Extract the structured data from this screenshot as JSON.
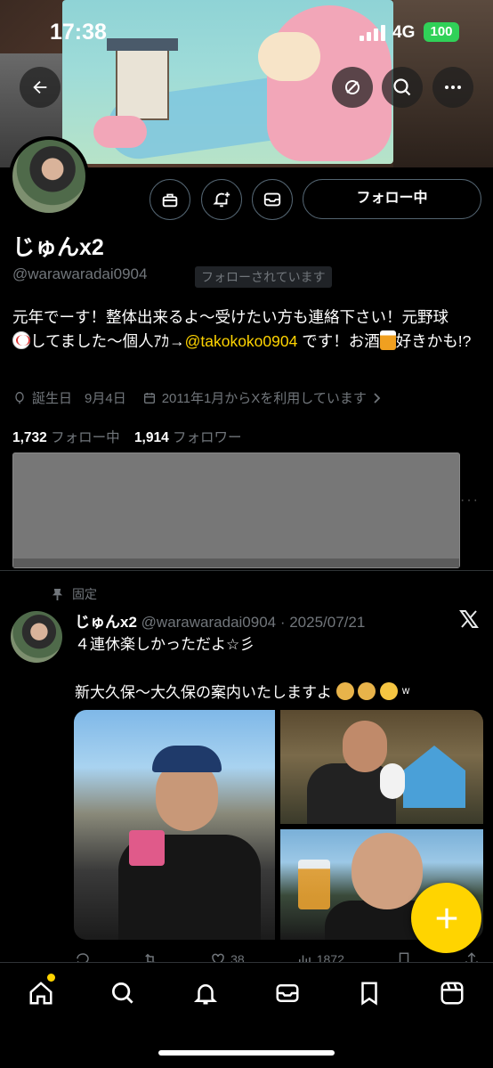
{
  "status_bar": {
    "time": "17:38",
    "network": "4G",
    "battery": "100"
  },
  "profile": {
    "name": "じゅんx2",
    "handle": "@warawaradai0904",
    "follows_you": "フォローされています",
    "follow_button": "フォロー中",
    "bio_part1": "元年でーす！整体出来るよ〜受けたい方も連絡下さい！元野球",
    "bio_part2": "してました〜個人ｱｶ→",
    "bio_mention": "@takokoko0904",
    "bio_part3": " です！お酒",
    "bio_part4": "好きかも!?",
    "birthday_label": "誕生日",
    "birthday_value": "9月4日",
    "joined": "2011年1月からXを利用しています",
    "following_count": "1,732",
    "following_label": "フォロー中",
    "followers_count": "1,914",
    "followers_label": "フォロワー"
  },
  "pinned_post": {
    "pinned_label": "固定",
    "author": "じゅんx2",
    "handle_date": "@warawaradai0904 · 2025/07/21",
    "line1": "４連休楽しかっただよ☆彡",
    "line2": "新大久保〜大久保の案内いたしますよ",
    "line2_tail": "ʷ",
    "likes": "38",
    "views": "1872"
  },
  "icons": {
    "back": "back-arrow-icon",
    "unmute": "eye-slash-icon",
    "search": "search-icon",
    "more": "more-icon",
    "subscribe": "gift-icon",
    "notify": "bell-plus-icon",
    "message": "mail-icon"
  },
  "colors": {
    "accent": "#ffd400",
    "muted": "#71767b",
    "battery": "#30d158"
  }
}
